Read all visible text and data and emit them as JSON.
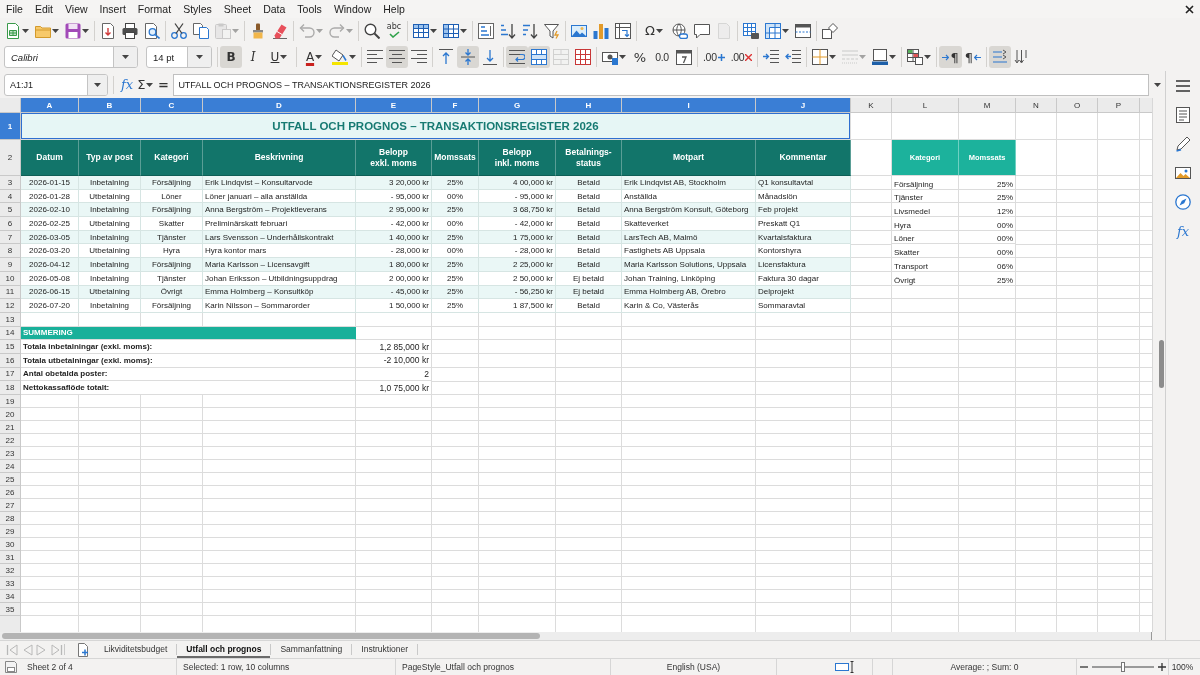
{
  "menu_bar": {
    "items": [
      "File",
      "Edit",
      "View",
      "Insert",
      "Format",
      "Styles",
      "Sheet",
      "Data",
      "Tools",
      "Window",
      "Help"
    ]
  },
  "standard_toolbar": {
    "groups": [
      [
        {
          "kind": "new",
          "dropdown": true,
          "disabled": false
        },
        {
          "kind": "open",
          "dropdown": true,
          "disabled": false
        },
        {
          "kind": "save",
          "dropdown": true,
          "disabled": false
        }
      ],
      [
        {
          "kind": "export-pdf",
          "dropdown": false,
          "disabled": false
        },
        {
          "kind": "print",
          "dropdown": false,
          "disabled": false
        },
        {
          "kind": "print-preview",
          "dropdown": false,
          "disabled": false
        }
      ],
      [
        {
          "kind": "cut",
          "dropdown": false,
          "disabled": false
        },
        {
          "kind": "copy",
          "dropdown": false,
          "disabled": false
        },
        {
          "kind": "paste",
          "dropdown": true,
          "disabled": true
        }
      ],
      [
        {
          "kind": "clone-formatting",
          "dropdown": false,
          "disabled": false
        },
        {
          "kind": "clear-formatting",
          "dropdown": false,
          "disabled": false
        }
      ],
      [
        {
          "kind": "undo",
          "dropdown": true,
          "disabled": true
        },
        {
          "kind": "redo",
          "dropdown": true,
          "disabled": true
        }
      ],
      [
        {
          "kind": "find-replace",
          "dropdown": false,
          "disabled": false
        },
        {
          "kind": "spelling",
          "label": "abc",
          "dropdown": false,
          "disabled": false
        }
      ],
      [
        {
          "kind": "insert-rows",
          "dropdown": true,
          "disabled": false
        },
        {
          "kind": "insert-columns",
          "dropdown": true,
          "disabled": false
        }
      ],
      [
        {
          "kind": "sort",
          "dropdown": false,
          "disabled": false
        },
        {
          "kind": "sort-ascending",
          "dropdown": false,
          "disabled": false
        },
        {
          "kind": "sort-descending",
          "dropdown": false,
          "disabled": false
        },
        {
          "kind": "autofilter",
          "dropdown": false,
          "disabled": false
        }
      ],
      [
        {
          "kind": "insert-image",
          "dropdown": false,
          "disabled": false
        },
        {
          "kind": "insert-chart",
          "dropdown": false,
          "disabled": false
        },
        {
          "kind": "pivot-table",
          "dropdown": false,
          "disabled": false
        }
      ],
      [
        {
          "kind": "special-character",
          "label": "Ω",
          "dropdown": true,
          "disabled": false
        },
        {
          "kind": "hyperlink",
          "dropdown": false,
          "disabled": false
        },
        {
          "kind": "comment",
          "dropdown": false,
          "disabled": false
        },
        {
          "kind": "headers-footers",
          "dropdown": false,
          "disabled": true
        }
      ],
      [
        {
          "kind": "print-area",
          "dropdown": false,
          "disabled": false
        },
        {
          "kind": "freeze-panes",
          "dropdown": true,
          "disabled": false
        },
        {
          "kind": "split-window",
          "dropdown": false,
          "disabled": false
        }
      ],
      [
        {
          "kind": "shapes",
          "dropdown": false,
          "disabled": false
        }
      ]
    ]
  },
  "formatting_toolbar": {
    "font_name": "Calibri",
    "font_size": "14 pt",
    "groups": [
      [
        {
          "kind": "bold",
          "label": "B",
          "dropdown": false,
          "on": true,
          "disabled": false
        },
        {
          "kind": "italic",
          "label": "I",
          "dropdown": false,
          "on": false,
          "disabled": false
        },
        {
          "kind": "underline",
          "label": "U",
          "dropdown": true,
          "on": false,
          "disabled": false
        }
      ],
      [
        {
          "kind": "font-color",
          "label": "A",
          "dropdown": true,
          "on": false,
          "disabled": false
        },
        {
          "kind": "highlight",
          "dropdown": true,
          "on": false,
          "disabled": false
        }
      ],
      [
        {
          "kind": "align-left",
          "dropdown": false,
          "on": false,
          "disabled": false
        },
        {
          "kind": "align-center",
          "dropdown": false,
          "on": true,
          "disabled": false
        },
        {
          "kind": "align-right",
          "dropdown": false,
          "on": false,
          "disabled": false
        }
      ],
      [
        {
          "kind": "align-top",
          "dropdown": false,
          "on": false,
          "disabled": false
        },
        {
          "kind": "align-middle",
          "dropdown": false,
          "on": true,
          "disabled": false
        },
        {
          "kind": "align-bottom",
          "dropdown": false,
          "on": false,
          "disabled": false
        }
      ],
      [
        {
          "kind": "wrap-text",
          "dropdown": false,
          "on": true,
          "disabled": false
        },
        {
          "kind": "merge-center",
          "dropdown": false,
          "on": true,
          "disabled": false
        },
        {
          "kind": "merge-cells",
          "dropdown": false,
          "on": false,
          "disabled": true
        },
        {
          "kind": "unmerge-cells",
          "dropdown": false,
          "on": false,
          "disabled": false
        }
      ],
      [
        {
          "kind": "currency",
          "dropdown": true,
          "on": false,
          "disabled": false
        },
        {
          "kind": "percent",
          "label": "%",
          "dropdown": false,
          "on": false,
          "disabled": false
        },
        {
          "kind": "number",
          "label": "0.0",
          "dropdown": false,
          "on": false,
          "disabled": false
        },
        {
          "kind": "date",
          "dropdown": false,
          "on": false,
          "disabled": false
        }
      ],
      [
        {
          "kind": "add-decimal",
          "label": ".00",
          "dropdown": false,
          "on": false,
          "disabled": false
        },
        {
          "kind": "delete-decimal",
          "label": ".00",
          "dropdown": false,
          "on": false,
          "disabled": false
        }
      ],
      [
        {
          "kind": "increase-indent",
          "dropdown": false,
          "on": false,
          "disabled": false
        },
        {
          "kind": "decrease-indent",
          "dropdown": false,
          "on": false,
          "disabled": false
        }
      ],
      [
        {
          "kind": "borders",
          "dropdown": true,
          "on": false,
          "disabled": false
        },
        {
          "kind": "border-style",
          "dropdown": true,
          "on": false,
          "disabled": true
        },
        {
          "kind": "border-color",
          "dropdown": true,
          "on": false,
          "disabled": false
        }
      ],
      [
        {
          "kind": "conditional",
          "dropdown": true,
          "on": false,
          "disabled": false
        }
      ],
      [
        {
          "kind": "left-to-right",
          "label": "¶",
          "dropdown": false,
          "on": true,
          "disabled": false
        },
        {
          "kind": "right-to-left",
          "label": "¶",
          "dropdown": false,
          "on": false,
          "disabled": false
        }
      ],
      [
        {
          "kind": "text-direction",
          "dropdown": false,
          "on": true,
          "disabled": false
        },
        {
          "kind": "vertical-text",
          "dropdown": false,
          "on": false,
          "disabled": false
        }
      ]
    ]
  },
  "formula_bar": {
    "name_box": "A1:J1",
    "function_wizard": "fx",
    "sum": "Σ",
    "equals": "=",
    "content": "UTFALL OCH PROGNOS – TRANSAKTIONSREGISTER 2026"
  },
  "sheet": {
    "column_headers": [
      {
        "label": "A",
        "selected": true
      },
      {
        "label": "B",
        "selected": true
      },
      {
        "label": "C",
        "selected": true
      },
      {
        "label": "D",
        "selected": true
      },
      {
        "label": "E",
        "selected": true
      },
      {
        "label": "F",
        "selected": true
      },
      {
        "label": "G",
        "selected": true
      },
      {
        "label": "H",
        "selected": true
      },
      {
        "label": "I",
        "selected": true
      },
      {
        "label": "J",
        "selected": true
      },
      {
        "label": "K",
        "selected": false
      },
      {
        "label": "L",
        "selected": false
      },
      {
        "label": "M",
        "selected": false
      },
      {
        "label": "N",
        "selected": false
      },
      {
        "label": "O",
        "selected": false
      },
      {
        "label": "P",
        "selected": false
      }
    ],
    "row_headers": [
      {
        "label": "1",
        "selected": true
      },
      {
        "label": "2",
        "selected": false
      },
      {
        "label": "3",
        "selected": false
      },
      {
        "label": "4",
        "selected": false
      },
      {
        "label": "5",
        "selected": false
      },
      {
        "label": "6",
        "selected": false
      },
      {
        "label": "7",
        "selected": false
      },
      {
        "label": "8",
        "selected": false
      },
      {
        "label": "9",
        "selected": false
      },
      {
        "label": "10",
        "selected": false
      },
      {
        "label": "11",
        "selected": false
      },
      {
        "label": "12",
        "selected": false
      },
      {
        "label": "13",
        "selected": false
      },
      {
        "label": "14",
        "selected": false
      },
      {
        "label": "15",
        "selected": false
      },
      {
        "label": "16",
        "selected": false
      },
      {
        "label": "17",
        "selected": false
      },
      {
        "label": "18",
        "selected": false
      },
      {
        "label": "19",
        "selected": false
      },
      {
        "label": "20",
        "selected": false
      },
      {
        "label": "21",
        "selected": false
      },
      {
        "label": "22",
        "selected": false
      },
      {
        "label": "23",
        "selected": false
      },
      {
        "label": "24",
        "selected": false
      },
      {
        "label": "25",
        "selected": false
      },
      {
        "label": "26",
        "selected": false
      },
      {
        "label": "27",
        "selected": false
      },
      {
        "label": "28",
        "selected": false
      },
      {
        "label": "29",
        "selected": false
      },
      {
        "label": "30",
        "selected": false
      },
      {
        "label": "31",
        "selected": false
      },
      {
        "label": "32",
        "selected": false
      },
      {
        "label": "33",
        "selected": false
      },
      {
        "label": "34",
        "selected": false
      },
      {
        "label": "35",
        "selected": false
      }
    ],
    "title": {
      "text": "UTFALL OCH PROGNOS – TRANSAKTIONSREGISTER 2026",
      "selected": true
    },
    "table": {
      "columns": [
        "Datum",
        "Typ av post",
        "Kategori",
        "Beskrivning",
        "Belopp\nexkl. moms",
        "Momssats",
        "Belopp\ninkl. moms",
        "Betalnings-\nstatus",
        "Motpart",
        "Kommentar"
      ],
      "rows": [
        [
          "2026-01-15",
          "Inbetalning",
          "Försäljning",
          "Erik Lindqvist – Konsultarvode",
          "3 20,000 kr",
          "25%",
          "4 00,000 kr",
          "Betald",
          "Erik Lindqvist AB, Stockholm",
          "Q1 konsultavtal"
        ],
        [
          "2026-01-28",
          "Utbetalning",
          "Löner",
          "Löner januari – alla anställda",
          "- 95,000 kr",
          "00%",
          "- 95,000 kr",
          "Betald",
          "Anställda",
          "Månadslön"
        ],
        [
          "2026-02-10",
          "Inbetalning",
          "Försäljning",
          "Anna Bergström – Projektleverans",
          "2 95,000 kr",
          "25%",
          "3 68,750 kr",
          "Betald",
          "Anna Bergström Konsult, Göteborg",
          "Feb projekt"
        ],
        [
          "2026-02-25",
          "Utbetalning",
          "Skatter",
          "Preliminärskatt februari",
          "- 42,000 kr",
          "00%",
          "- 42,000 kr",
          "Betald",
          "Skatteverket",
          "Preskatt Q1"
        ],
        [
          "2026-03-05",
          "Inbetalning",
          "Tjänster",
          "Lars Svensson – Underhållskontrakt",
          "1 40,000 kr",
          "25%",
          "1 75,000 kr",
          "Betald",
          "LarsTech AB, Malmö",
          "Kvartalsfaktura"
        ],
        [
          "2026-03-20",
          "Utbetalning",
          "Hyra",
          "Hyra kontor mars",
          "- 28,000 kr",
          "00%",
          "- 28,000 kr",
          "Betald",
          "Fastighets AB Uppsala",
          "Kontorshyra"
        ],
        [
          "2026-04-12",
          "Inbetalning",
          "Försäljning",
          "Maria Karlsson – Licensavgift",
          "1 80,000 kr",
          "25%",
          "2 25,000 kr",
          "Betald",
          "Maria Karlsson Solutions, Uppsala",
          "Licensfaktura"
        ],
        [
          "2026-05-08",
          "Inbetalning",
          "Tjänster",
          "Johan Eriksson – Utbildningsuppdrag",
          "2 00,000 kr",
          "25%",
          "2 50,000 kr",
          "Ej betald",
          "Johan Training, Linköping",
          "Faktura 30 dagar"
        ],
        [
          "2026-06-15",
          "Utbetalning",
          "Övrigt",
          "Emma Holmberg – Konsultköp",
          "- 45,000 kr",
          "25%",
          "- 56,250 kr",
          "Ej betald",
          "Emma Holmberg AB, Örebro",
          "Delprojekt"
        ],
        [
          "2026-07-20",
          "Inbetalning",
          "Försäljning",
          "Karin Nilsson – Sommarorder",
          "1 50,000 kr",
          "25%",
          "1 87,500 kr",
          "Betald",
          "Karin & Co, Västerås",
          "Sommaravtal"
        ]
      ]
    },
    "vat_table": {
      "columns": [
        "Kategori",
        "Momssats"
      ],
      "rows": [
        [
          "Försäljning",
          "25%"
        ],
        [
          "Tjänster",
          "25%"
        ],
        [
          "Livsmedel",
          "12%"
        ],
        [
          "Hyra",
          "00%"
        ],
        [
          "Löner",
          "00%"
        ],
        [
          "Skatter",
          "00%"
        ],
        [
          "Transport",
          "06%"
        ],
        [
          "Övrigt",
          "25%"
        ]
      ]
    },
    "summary": {
      "heading": "SUMMERING",
      "rows": [
        {
          "label": "Totala inbetalningar (exkl. moms):",
          "value": "1,2 85,000 kr"
        },
        {
          "label": "Totala utbetalningar (exkl. moms):",
          "value": "-2 10,000 kr"
        },
        {
          "label": "Antal obetalda poster:",
          "value": "2"
        },
        {
          "label": "Nettokassaflöde totalt:",
          "value": "1,0 75,000 kr"
        }
      ]
    }
  },
  "sidebar": {
    "items": [
      {
        "kind": "menu"
      },
      {
        "kind": "properties"
      },
      {
        "kind": "styles"
      },
      {
        "kind": "gallery"
      },
      {
        "kind": "navigator"
      },
      {
        "kind": "functions",
        "label": "fx"
      }
    ]
  },
  "sheet_tabs": [
    {
      "label": "Likviditetsbudget",
      "selected": false
    },
    {
      "label": "Utfall och prognos",
      "selected": true
    },
    {
      "label": "Sammanfattning",
      "selected": false
    },
    {
      "label": "Instruktioner",
      "selected": false
    }
  ],
  "status_bar": {
    "sheet": "Sheet 2 of 4",
    "selection": "Selected: 1 row, 10 columns",
    "page_style": "PageStyle_Utfall och prognos",
    "language": "English (USA)",
    "statistics": "Average: ; Sum: 0",
    "zoom": {
      "level": 0.5,
      "label": "100%"
    }
  }
}
